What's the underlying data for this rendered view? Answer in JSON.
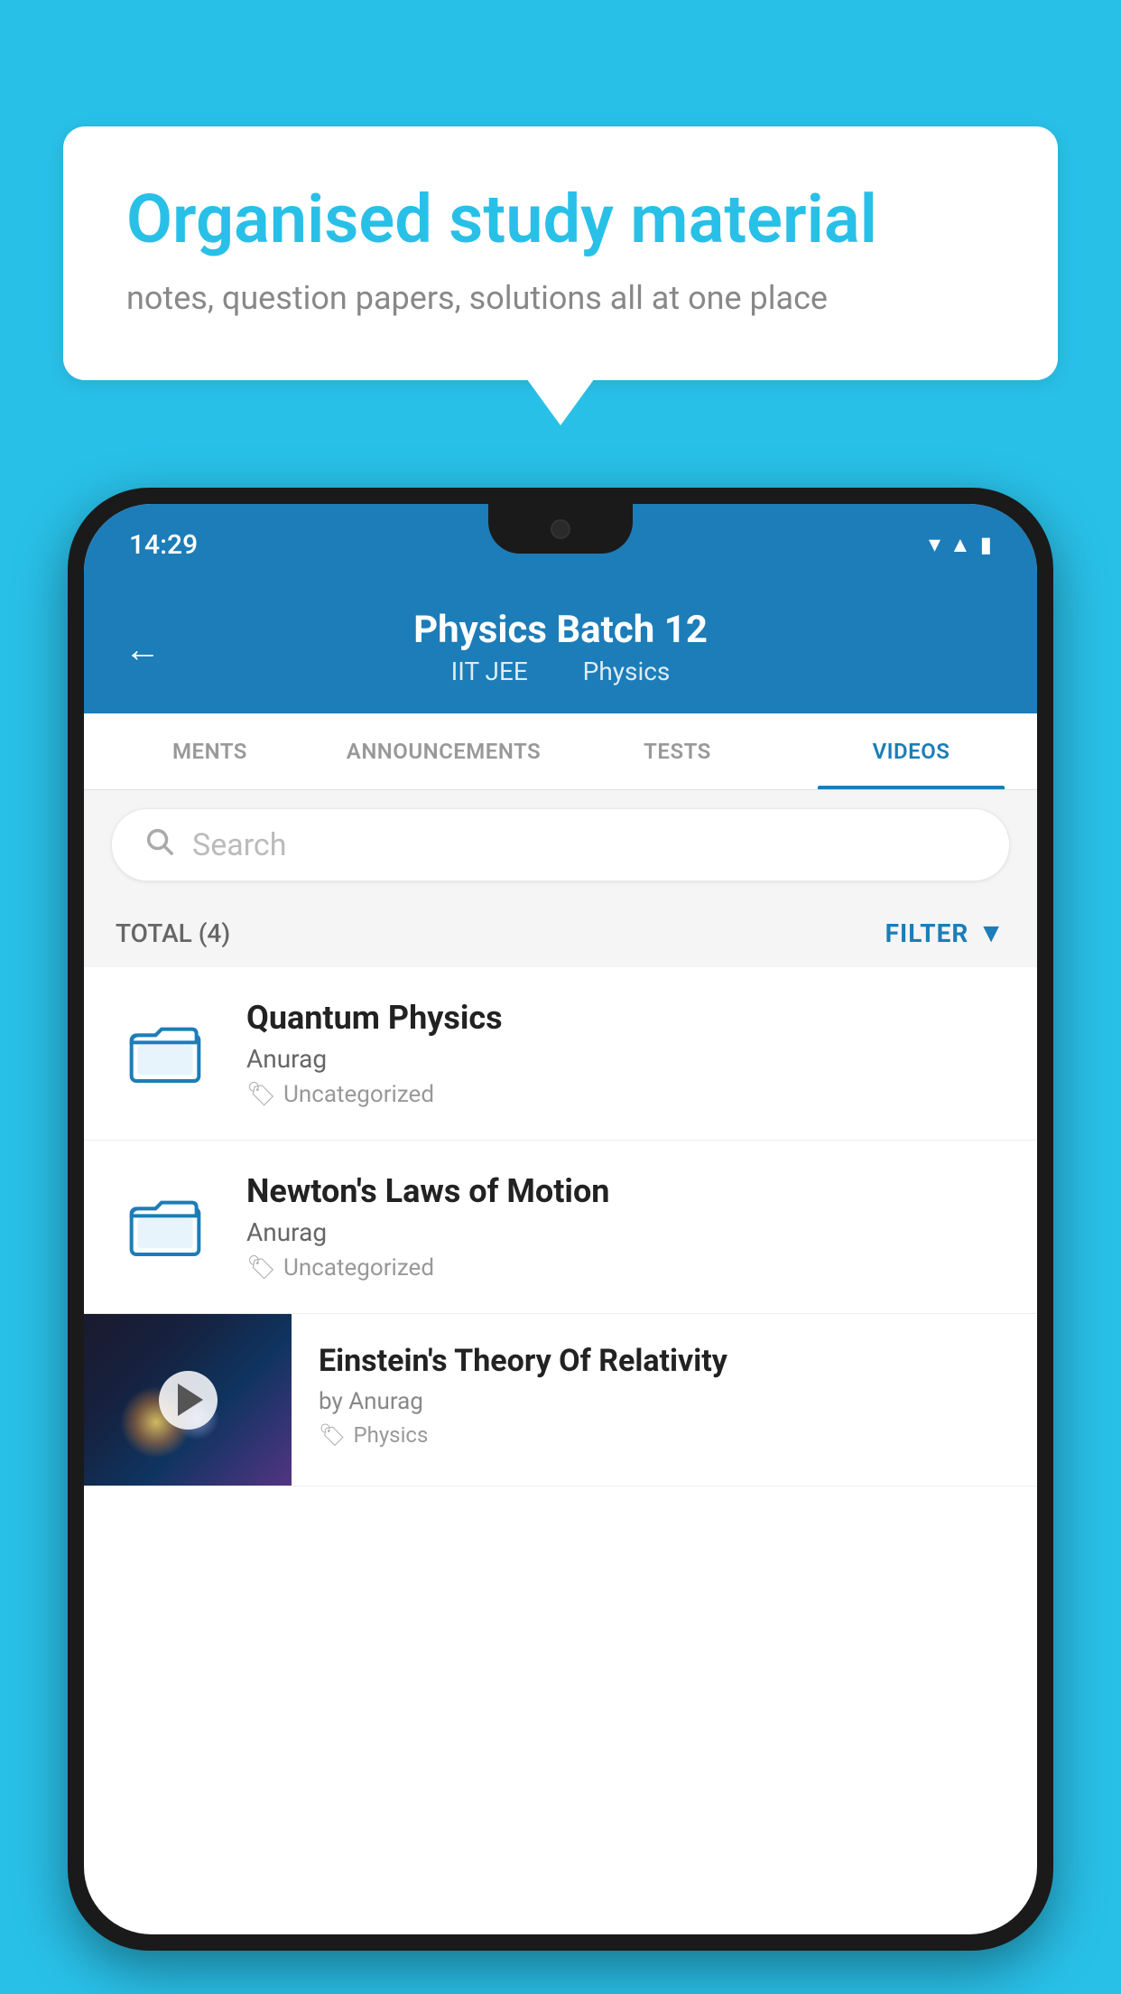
{
  "background_color": "#29C0E8",
  "speech_bubble": {
    "title": "Organised study material",
    "subtitle": "notes, question papers, solutions all at one place"
  },
  "phone": {
    "status_bar": {
      "time": "14:29",
      "wifi": "▾",
      "signal": "▲",
      "battery": "▮"
    },
    "header": {
      "back_label": "←",
      "title": "Physics Batch 12",
      "subtitle_part1": "IIT JEE",
      "subtitle_part2": "Physics"
    },
    "tabs": [
      {
        "label": "MENTS",
        "active": false
      },
      {
        "label": "ANNOUNCEMENTS",
        "active": false
      },
      {
        "label": "TESTS",
        "active": false
      },
      {
        "label": "VIDEOS",
        "active": true
      }
    ],
    "search": {
      "placeholder": "Search"
    },
    "filter_bar": {
      "total_label": "TOTAL (4)",
      "filter_label": "FILTER"
    },
    "videos": [
      {
        "id": 1,
        "title": "Quantum Physics",
        "author": "Anurag",
        "tag": "Uncategorized",
        "has_thumb": false
      },
      {
        "id": 2,
        "title": "Newton's Laws of Motion",
        "author": "Anurag",
        "tag": "Uncategorized",
        "has_thumb": false
      },
      {
        "id": 3,
        "title": "Einstein's Theory Of Relativity",
        "author": "by Anurag",
        "tag": "Physics",
        "has_thumb": true
      }
    ]
  }
}
